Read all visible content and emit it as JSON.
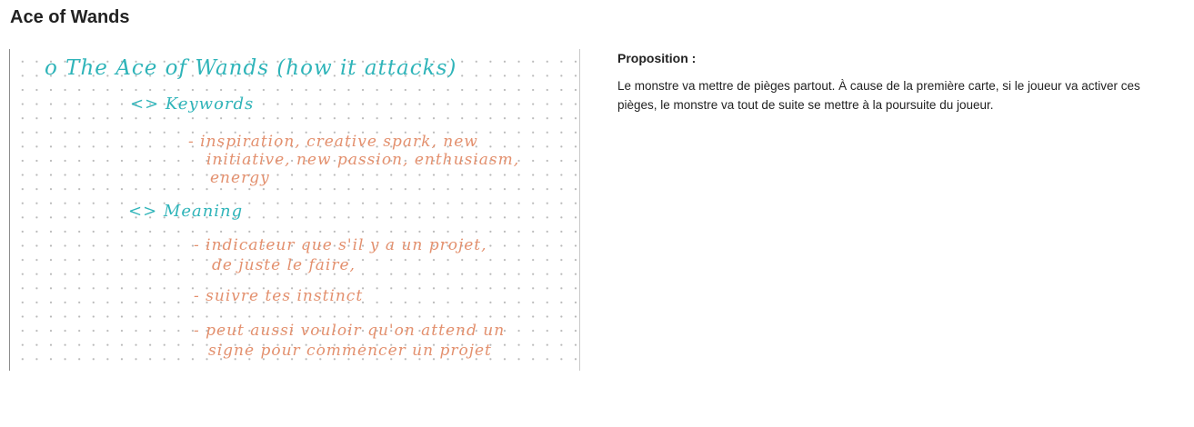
{
  "title": "Ace of Wands",
  "notes": {
    "heading": "o The Ace of Wands (how it attacks)",
    "keywords_label": "<> Keywords",
    "keywords_lines": [
      "- inspiration, creative spark, new",
      "initiative, new passion, enthusiasm,",
      "energy"
    ],
    "meaning_label": "<> Meaning",
    "meaning_lines": [
      "- indicateur que s'il y a un projet,",
      "de juste le faire,",
      "- suivre tes instinct",
      "- peut aussi vouloir qu'on attend un",
      "signe pour commencer un projet"
    ]
  },
  "proposition": {
    "label": "Proposition :",
    "text": "Le monstre va mettre de pièges partout. À cause de la première carte, si le joueur va activer ces pièges, le monstre va tout de suite se mettre à la poursuite du joueur."
  },
  "colors": {
    "teal_ink": "#2fb4b9",
    "salmon_ink": "#e3906e"
  }
}
